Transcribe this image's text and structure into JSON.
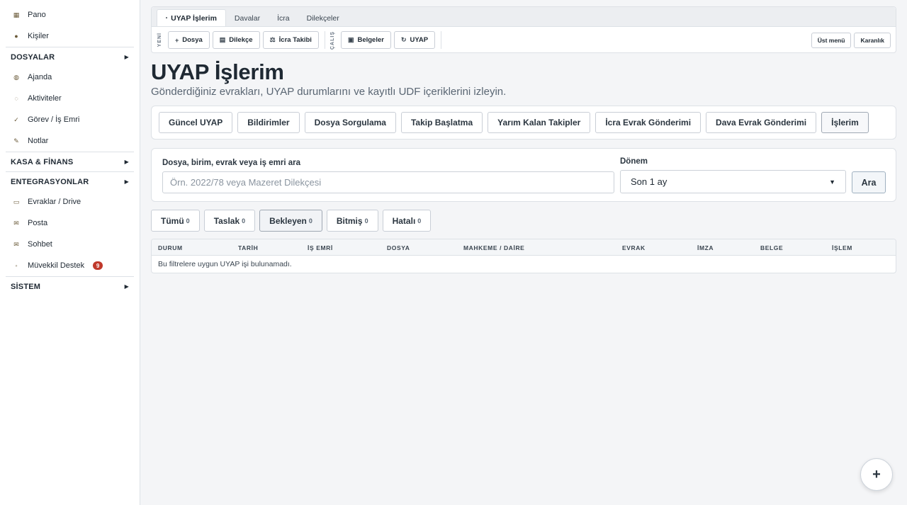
{
  "sidebar": {
    "items_top": [
      {
        "label": "Pano",
        "icon": "dashboard-icon",
        "glyph": "▦"
      },
      {
        "label": "Kişiler",
        "icon": "people-icon",
        "glyph": "●"
      }
    ],
    "section_dosyalar": "DOSYALAR",
    "items_mid": [
      {
        "label": "Ajanda",
        "icon": "calendar-icon",
        "glyph": "◍"
      },
      {
        "label": "Aktiviteler",
        "icon": "activity-icon",
        "glyph": "◌"
      },
      {
        "label": "Görev / İş Emri",
        "icon": "check-icon",
        "glyph": "✓"
      },
      {
        "label": "Notlar",
        "icon": "note-icon",
        "glyph": "✎"
      }
    ],
    "section_kasa": "KASA & FİNANS",
    "section_entegrasyonlar": "ENTEGRASYONLAR",
    "items_bottom": [
      {
        "label": "Evraklar / Drive",
        "icon": "folder-icon",
        "glyph": "▭"
      },
      {
        "label": "Posta",
        "icon": "mail-icon",
        "glyph": "✉"
      },
      {
        "label": "Sohbet",
        "icon": "chat-icon",
        "glyph": "✉"
      },
      {
        "label": "Müvekkil Destek",
        "icon": "support-icon",
        "glyph": "◦",
        "badge": "9"
      }
    ],
    "section_sistem": "SİSTEM",
    "arrow_glyph": "▶"
  },
  "toolbar": {
    "tabs": [
      "UYAP İşlerim",
      "Davalar",
      "İcra",
      "Dilekçeler"
    ],
    "active_tab_dot": "•",
    "new_label": "YENİ",
    "work_label": "ÇALIŞ",
    "btn_dosya": "Dosya",
    "btn_dilekce": "Dilekçe",
    "btn_icra_takibi": "İcra Takibi",
    "btn_belgeler": "Belgeler",
    "btn_uyap": "UYAP",
    "btn_ust_menu": "Üst menü",
    "btn_karanlik": "Karanlık"
  },
  "page": {
    "title": "UYAP İşlerim",
    "subtitle": "Gönderdiğiniz evrakları, UYAP durumlarını ve kayıtlı UDF içeriklerini izleyin."
  },
  "subnav": {
    "items": [
      "Güncel UYAP",
      "Bildirimler",
      "Dosya Sorgulama",
      "Takip Başlatma",
      "Yarım Kalan Takipler",
      "İcra Evrak Gönderimi",
      "Dava Evrak Gönderimi",
      "İşlerim"
    ],
    "active": "İşlerim"
  },
  "search": {
    "label": "Dosya, birim, evrak veya iş emri ara",
    "placeholder": "Örn. 2022/78 veya Mazeret Dilekçesi",
    "value": "",
    "period_label": "Dönem",
    "period_value": "Son 1 ay",
    "button": "Ara"
  },
  "filters": [
    {
      "label": "Tümü",
      "count": "0"
    },
    {
      "label": "Taslak",
      "count": "0"
    },
    {
      "label": "Bekleyen",
      "count": "0",
      "active": true
    },
    {
      "label": "Bitmiş",
      "count": "0"
    },
    {
      "label": "Hatalı",
      "count": "0"
    }
  ],
  "table": {
    "columns": [
      "DURUM",
      "TARİH",
      "İŞ EMRİ",
      "DOSYA",
      "MAHKEME / DAİRE",
      "EVRAK",
      "İMZA",
      "BELGE",
      "İŞLEM"
    ],
    "empty_message": "Bu filtrelere uygun UYAP işi bulunamadı."
  },
  "fab": {
    "label": "+"
  },
  "colors": {
    "badge": "#c0392b",
    "background": "#f4f5f7"
  }
}
